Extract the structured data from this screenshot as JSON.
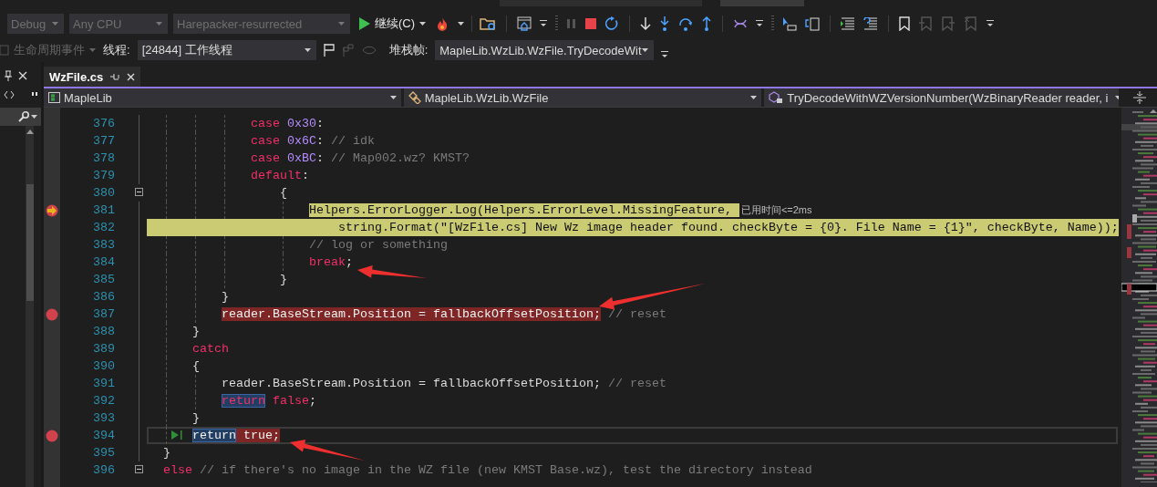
{
  "toolbar": {
    "configs": [
      {
        "value": "Debug",
        "disabled": true
      },
      {
        "value": "Any CPU",
        "disabled": true
      },
      {
        "value": "Harepacker-resurrected",
        "disabled": true
      }
    ],
    "continue_button": "继续(C)"
  },
  "debug_bar": {
    "lifecycle": {
      "label": "生命周期事件",
      "disabled": true
    },
    "thread_label": "线程:",
    "thread": "[24844] 工作线程",
    "stack_label": "堆栈帧:",
    "stack_frame": "MapleLib.WzLib.WzFile.TryDecodeWit"
  },
  "tabs": [
    {
      "label": "WzFile.cs",
      "selected": true
    }
  ],
  "nav": {
    "project": "MapleLib",
    "type": "MapleLib.WzLib.WzFile",
    "member": "TryDecodeWithWZVersionNumber(WzBinaryReader reader, i"
  },
  "editor": {
    "lines": [
      {
        "number": "376",
        "breakpoint": false,
        "execution_arrow": false,
        "line_fill": false,
        "fold": false,
        "caret_line": false,
        "tokens": [
          {
            "text": "case",
            "kind": "keyword"
          },
          {
            "text": " 0x30",
            "kind": "number"
          },
          {
            "text": ":",
            "kind": "text"
          }
        ]
      },
      {
        "number": "377",
        "breakpoint": false,
        "execution_arrow": false,
        "line_fill": false,
        "fold": false,
        "caret_line": false,
        "tokens": [
          {
            "text": "case",
            "kind": "keyword"
          },
          {
            "text": " 0x6C",
            "kind": "number"
          },
          {
            "text": ": ",
            "kind": "text"
          },
          {
            "text": "// idk",
            "kind": "comment"
          }
        ]
      },
      {
        "number": "378",
        "breakpoint": false,
        "execution_arrow": false,
        "line_fill": false,
        "fold": false,
        "caret_line": false,
        "tokens": [
          {
            "text": "case",
            "kind": "keyword"
          },
          {
            "text": " 0xBC",
            "kind": "number"
          },
          {
            "text": ": ",
            "kind": "text"
          },
          {
            "text": "// Map002.wz? KMST?",
            "kind": "comment"
          }
        ]
      },
      {
        "number": "379",
        "breakpoint": false,
        "execution_arrow": false,
        "line_fill": false,
        "fold": false,
        "caret_line": false,
        "tokens": [
          {
            "text": "default",
            "kind": "keyword"
          },
          {
            "text": ":",
            "kind": "text"
          }
        ]
      },
      {
        "number": "380",
        "breakpoint": false,
        "execution_arrow": false,
        "line_fill": false,
        "fold": true,
        "caret_line": false,
        "tokens": [
          {
            "text": "{",
            "kind": "text"
          }
        ]
      },
      {
        "number": "381",
        "breakpoint": true,
        "execution_arrow": true,
        "line_fill": false,
        "fold": false,
        "caret_line": false,
        "hint": "已用时间<=2ms",
        "tokens": [
          {
            "text": "Helpers.ErrorLogger.Log(Helpers.ErrorLevel.MissingFeature, ",
            "kind": "text",
            "current": true
          }
        ]
      },
      {
        "number": "382",
        "breakpoint": false,
        "execution_arrow": false,
        "line_fill": true,
        "fold": false,
        "caret_line": false,
        "tokens": [
          {
            "text": "string.Format(\"[WzFile.cs] New Wz image header found. checkByte = {0}. File Name = {1}\", checkByte, Name));",
            "kind": "text"
          }
        ]
      },
      {
        "number": "383",
        "breakpoint": false,
        "execution_arrow": false,
        "line_fill": false,
        "fold": false,
        "caret_line": false,
        "tokens": [
          {
            "text": "// log or something",
            "kind": "comment"
          }
        ]
      },
      {
        "number": "384",
        "breakpoint": false,
        "execution_arrow": false,
        "line_fill": false,
        "fold": false,
        "caret_line": false,
        "tokens": [
          {
            "text": "break",
            "kind": "keyword"
          },
          {
            "text": ";",
            "kind": "text"
          }
        ]
      },
      {
        "number": "385",
        "breakpoint": false,
        "execution_arrow": false,
        "line_fill": false,
        "fold": false,
        "caret_line": false,
        "tokens": [
          {
            "text": "}",
            "kind": "text"
          }
        ]
      },
      {
        "number": "386",
        "breakpoint": false,
        "execution_arrow": false,
        "line_fill": false,
        "fold": false,
        "caret_line": false,
        "tokens": [
          {
            "text": "}",
            "kind": "text"
          }
        ]
      },
      {
        "number": "387",
        "breakpoint": true,
        "execution_arrow": false,
        "line_fill": false,
        "fold": false,
        "caret_line": false,
        "tokens": [
          {
            "text": "reader.BaseStream.Position = fallbackOffsetPosition;",
            "kind": "text",
            "breakpoint": true
          },
          {
            "text": " // reset",
            "kind": "comment"
          }
        ]
      },
      {
        "number": "388",
        "breakpoint": false,
        "execution_arrow": false,
        "line_fill": false,
        "fold": false,
        "caret_line": false,
        "tokens": [
          {
            "text": "}",
            "kind": "text"
          }
        ]
      },
      {
        "number": "389",
        "breakpoint": false,
        "execution_arrow": false,
        "line_fill": false,
        "fold": false,
        "caret_line": false,
        "tokens": [
          {
            "text": "catch",
            "kind": "keyword"
          }
        ]
      },
      {
        "number": "390",
        "breakpoint": false,
        "execution_arrow": false,
        "line_fill": false,
        "fold": false,
        "caret_line": false,
        "tokens": [
          {
            "text": "{",
            "kind": "text"
          }
        ]
      },
      {
        "number": "391",
        "breakpoint": false,
        "execution_arrow": false,
        "line_fill": false,
        "fold": false,
        "caret_line": false,
        "tokens": [
          {
            "text": "reader.BaseStream.Position = fallbackOffsetPosition; ",
            "kind": "text"
          },
          {
            "text": "// reset",
            "kind": "comment"
          }
        ]
      },
      {
        "number": "392",
        "breakpoint": false,
        "execution_arrow": false,
        "line_fill": false,
        "fold": false,
        "caret_line": false,
        "tokens": [
          {
            "text": "return",
            "kind": "keyword",
            "reference": true
          },
          {
            "text": " false",
            "kind": "keyword"
          },
          {
            "text": ";",
            "kind": "text"
          }
        ]
      },
      {
        "number": "393",
        "breakpoint": false,
        "execution_arrow": false,
        "line_fill": false,
        "fold": false,
        "caret_line": false,
        "tokens": [
          {
            "text": "}",
            "kind": "text"
          }
        ]
      },
      {
        "number": "394",
        "breakpoint": true,
        "execution_arrow": false,
        "line_fill": false,
        "fold": false,
        "caret_line": true,
        "run_to_click": true,
        "tokens": [
          {
            "text": "return",
            "kind": "text",
            "reference": true
          },
          {
            "text": " true;",
            "kind": "text",
            "breakpoint": true
          }
        ]
      },
      {
        "number": "395",
        "breakpoint": false,
        "execution_arrow": false,
        "line_fill": false,
        "fold": false,
        "caret_line": false,
        "tokens": [
          {
            "text": "}",
            "kind": "text"
          }
        ]
      },
      {
        "number": "396",
        "breakpoint": false,
        "execution_arrow": false,
        "line_fill": false,
        "fold": true,
        "caret_line": false,
        "tokens": [
          {
            "text": "else",
            "kind": "keyword"
          },
          {
            "text": " // if there's no image in the WZ file (new KMST Base.wz), test the directory instead",
            "kind": "comment"
          }
        ]
      }
    ]
  }
}
